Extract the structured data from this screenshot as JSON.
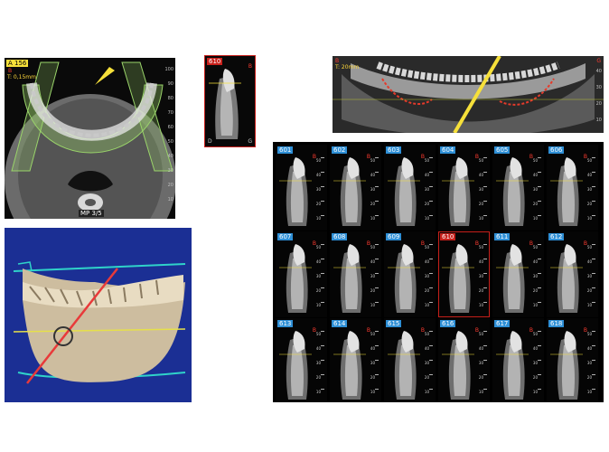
{
  "axial_view": {
    "slice_tag": "A 156",
    "marker": "B",
    "thickness": "T: 0,15mm",
    "mpr_label": "MP 3/5",
    "ruler": [
      "100",
      "90",
      "80",
      "70",
      "60",
      "50",
      "40",
      "30",
      "20",
      "10"
    ]
  },
  "cross_preview": {
    "slice_tag": "610",
    "marker": "B",
    "corner_left": "D",
    "corner_right": "G"
  },
  "panoramic_view": {
    "marker": "B",
    "thickness": "T: 20mm",
    "corner": "G",
    "ruler": [
      "40",
      "30",
      "20",
      "10"
    ]
  },
  "render_3d": {},
  "cross_sections": {
    "scale_labels": [
      "50",
      "40",
      "30",
      "20",
      "10"
    ],
    "slices": [
      {
        "label": "601"
      },
      {
        "label": "602"
      },
      {
        "label": "603"
      },
      {
        "label": "604"
      },
      {
        "label": "605"
      },
      {
        "label": "606"
      },
      {
        "label": "607"
      },
      {
        "label": "608"
      },
      {
        "label": "609"
      },
      {
        "label": "610",
        "selected": true
      },
      {
        "label": "611"
      },
      {
        "label": "612"
      },
      {
        "label": "613"
      },
      {
        "label": "614"
      },
      {
        "label": "615"
      },
      {
        "label": "616"
      },
      {
        "label": "617"
      },
      {
        "label": "618"
      }
    ]
  },
  "colors": {
    "accent_yellow": "#f6e03a",
    "tag_blue": "#2e8fd6",
    "marker_red": "#c8201b",
    "arch_green": "#9ad46a",
    "render_bg": "#1b2f94"
  }
}
